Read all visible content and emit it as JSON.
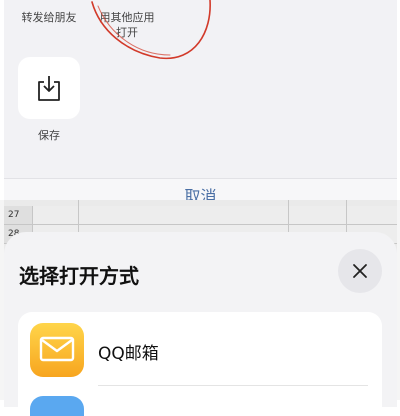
{
  "share_sheet": {
    "forward_label": "转发给朋友",
    "other_app_label_line1": "用其他应用",
    "other_app_label_line2": "打开",
    "save_label": "保存",
    "cancel_label": "取消"
  },
  "spreadsheet": {
    "row_numbers": [
      "27",
      "28"
    ]
  },
  "bottom_sheet": {
    "title": "选择打开方式",
    "apps": [
      {
        "name": "QQ邮箱",
        "icon": "qq-mail-icon"
      }
    ]
  },
  "colors": {
    "annotation_red": "#d23a2a",
    "qqmail_yellow": "#f7a51f",
    "cancel_blue": "#4a6fa5"
  }
}
